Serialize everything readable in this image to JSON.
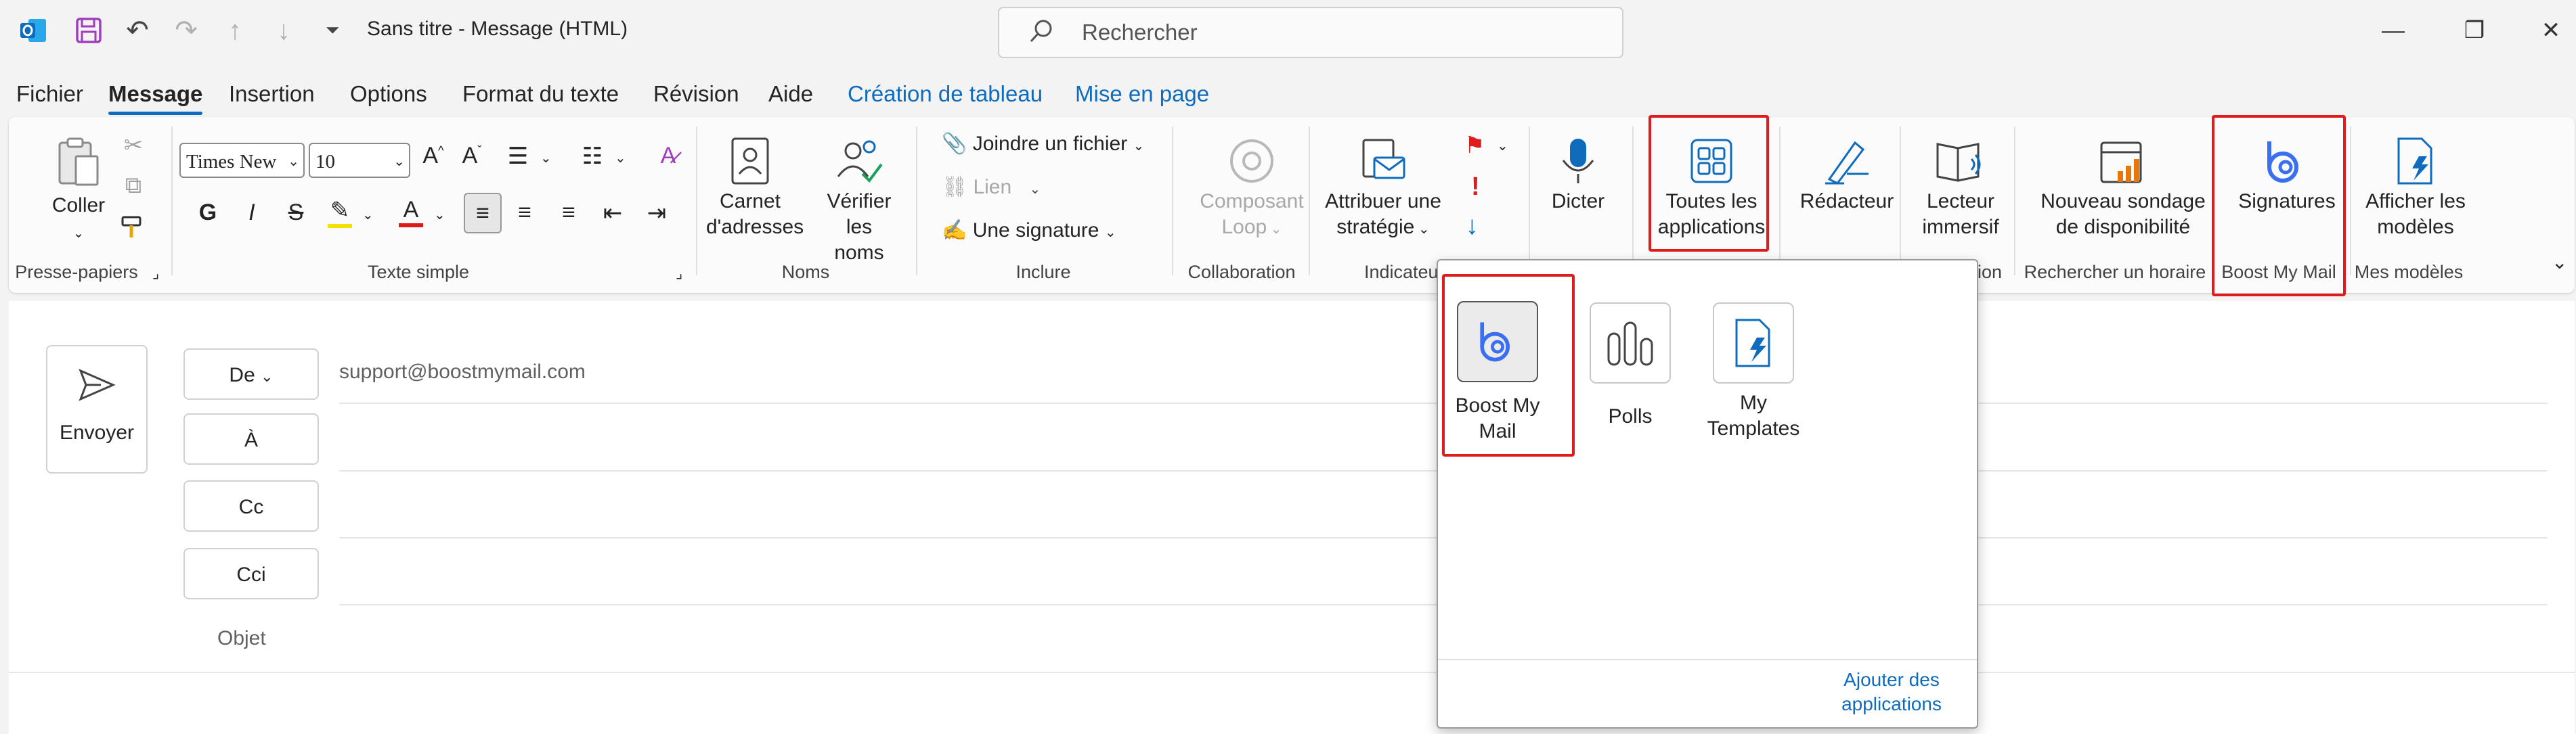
{
  "window": {
    "title": "Sans titre  -  Message (HTML)",
    "search_placeholder": "Rechercher",
    "minimize": "—",
    "restore": "❐",
    "close": "✕"
  },
  "tabs": [
    {
      "label": "Fichier"
    },
    {
      "label": "Message"
    },
    {
      "label": "Insertion"
    },
    {
      "label": "Options"
    },
    {
      "label": "Format du texte"
    },
    {
      "label": "Révision"
    },
    {
      "label": "Aide"
    },
    {
      "label": "Création de tableau"
    },
    {
      "label": "Mise en page"
    }
  ],
  "ribbon": {
    "clipboard": {
      "paste": "Coller",
      "group": "Presse-papiers"
    },
    "basic_text": {
      "font": "Times New Roman",
      "size": "10",
      "bold": "G",
      "italic": "I",
      "strike": "S",
      "group": "Texte simple"
    },
    "names": {
      "address_book_l1": "Carnet",
      "address_book_l2": "d'adresses",
      "check_names_l1": "Vérifier",
      "check_names_l2": "les noms",
      "group": "Noms"
    },
    "include": {
      "attach": "Joindre un fichier",
      "link": "Lien",
      "signature": "Une signature",
      "group": "Inclure"
    },
    "collaboration": {
      "loop_l1": "Composant",
      "loop_l2": "Loop",
      "group": "Collaboration"
    },
    "tags": {
      "policy_l1": "Attribuer une",
      "policy_l2": "stratégie",
      "group": "Indicateurs"
    },
    "voice": {
      "dictate": "Dicter"
    },
    "apps": {
      "all_apps_l1": "Toutes les",
      "all_apps_l2": "applications"
    },
    "editor": {
      "label": "Rédacteur"
    },
    "immersive": {
      "l1": "Lecteur",
      "l2": "immersif",
      "group_fragment": "ion"
    },
    "schedule": {
      "l1": "Nouveau sondage",
      "l2": "de disponibilité",
      "group": "Rechercher un horaire"
    },
    "bmm": {
      "signatures": "Signatures",
      "group": "Boost My Mail"
    },
    "templates": {
      "l1": "Afficher les",
      "l2": "modèles",
      "group": "Mes modèles"
    }
  },
  "compose": {
    "send": "Envoyer",
    "from_btn": "De",
    "from_value": "support@boostmymail.com",
    "to_btn": "À",
    "cc_btn": "Cc",
    "bcc_btn": "Cci",
    "subject_label": "Objet"
  },
  "popup": {
    "apps": [
      {
        "l1": "Boost My",
        "l2": "Mail",
        "icon": "boost-my-mail-logo"
      },
      {
        "l1": "Polls",
        "l2": "",
        "icon": "polls-bars-icon"
      },
      {
        "l1": "My",
        "l2": "Templates",
        "icon": "templates-doc-icon"
      }
    ],
    "add_apps_l1": "Ajouter des",
    "add_apps_l2": "applications"
  },
  "colors": {
    "accent": "#0f6cbd",
    "highlight_box": "#e01b1b",
    "bmm_blue": "#3a6ff2"
  }
}
